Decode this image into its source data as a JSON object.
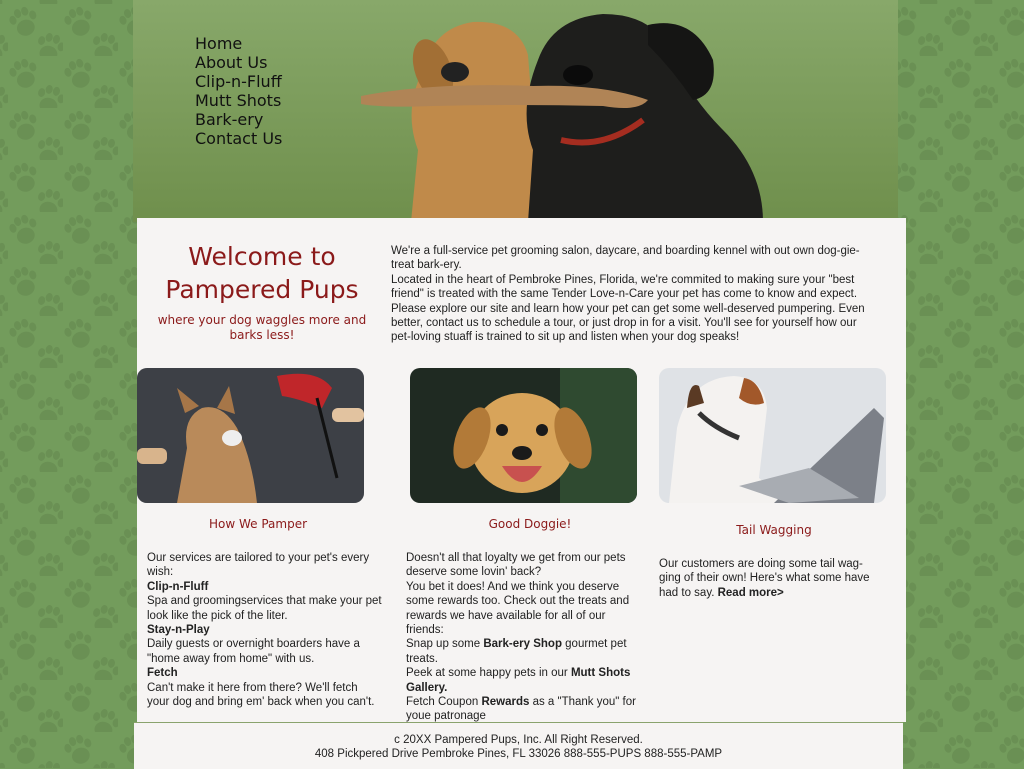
{
  "nav": [
    "Home",
    "About Us",
    "Clip-n-Fluff",
    "Mutt Shots",
    "Bark-ery",
    "Contact Us"
  ],
  "welcome": {
    "title_line1": "Welcome to",
    "title_line2": "Pampered Pups",
    "tagline": "where your dog waggles more and barks less!"
  },
  "intro": [
    "We're a full-service pet grooming salon, daycare, and boarding kennel with out own dog-gie-treat bark-ery.",
    "Located in the heart of Pembroke Pines, Florida, we're commited to making sure your \"best friend\" is treated with the same Tender Love-n-Care your pet has come to know and expect. Please explore our site and learn how your pet can get some well-deserved pumpering. Even better, contact us to schedule a tour, or just drop in for a visit. You'll see for yourself how our pet-loving stuaff is trained to sit up and listen when your dog speaks!"
  ],
  "col1": {
    "heading": "How We Pamper",
    "intro": "Our services are tailored to your pet's every wish:",
    "items": [
      {
        "title": "Clip-n-Fluff",
        "text": "Spa and groomingservices that make your pet look like the pick of the liter."
      },
      {
        "title": "Stay-n-Play",
        "text": "Daily guests or overnight boarders have a \"home away from home\" with us."
      },
      {
        "title": "Fetch",
        "text": "Can't make it here from there? We'll fetch your dog and bring em' back when you can't."
      }
    ]
  },
  "col2": {
    "heading": "Good Doggie!",
    "p1": "Doesn't all that loyalty we get from our pets deserve some lovin' back?",
    "p2": "You bet it does! And we think you deserve some rewards too. Check out the treats and rewards we have available for all of our friends:",
    "p3_pre": "Snap up some ",
    "p3_bold": "Bark-ery Shop",
    "p3_post": " gourmet pet treats.",
    "p4_pre": "Peek at some happy pets in our ",
    "p4_bold": "Mutt Shots Gallery.",
    "p5_pre": "Fetch Coupon ",
    "p5_bold": "Rewards",
    "p5_post": " as a \"Thank you\" for youe patronage"
  },
  "col3": {
    "heading": "Tail Wagging",
    "text": "Our customers are doing some tail wag-ging of their own! Here's what some have had to say. ",
    "link": "Read more>"
  },
  "footer": {
    "line1": "c 20XX Pampered Pups, Inc. All Right Reserved.",
    "line2": "408 Pickpered Drive Pembroke Pines, FL 33026 888-555-PUPS  888-555-PAMP"
  },
  "colors": {
    "accent": "#8b1a1a",
    "background": "#739c5c",
    "panel": "#f6f4f3"
  }
}
